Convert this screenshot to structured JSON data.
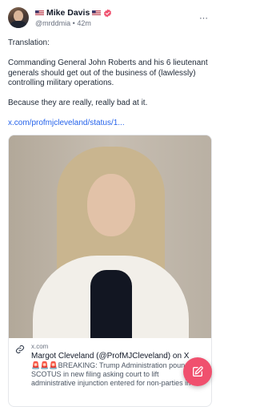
{
  "post": {
    "author": {
      "flag_left": "us-flag-icon",
      "name": "Mike Davis",
      "flag_right": "us-flag-icon",
      "verified_icon": "verified-badge-icon",
      "handle": "@mrddmia",
      "separator": "•",
      "time": "42m"
    },
    "text": {
      "p1": "Translation:",
      "p2": "Commanding General John Roberts and his 6 lieutenant generals should get out of the business of (lawlessly) controlling military operations.",
      "p3": "Because they are really, really bad at it.",
      "link": "x.com/profmjcleveland/status/1..."
    },
    "link_card": {
      "icon": "link-icon",
      "domain": "x.com",
      "title": "Margot Cleveland (@ProfMJCleveland) on X",
      "description": "🚨🚨🚨BREAKING: Trump Administration pounds SCOTUS in new filing asking court to lift administrative injunction entered for non-parties in the Alien Enemies"
    }
  },
  "fab": {
    "icon": "compose-icon"
  },
  "colors": {
    "accent": "#f0506e",
    "link": "#2563eb",
    "verified": "#f0506e"
  }
}
